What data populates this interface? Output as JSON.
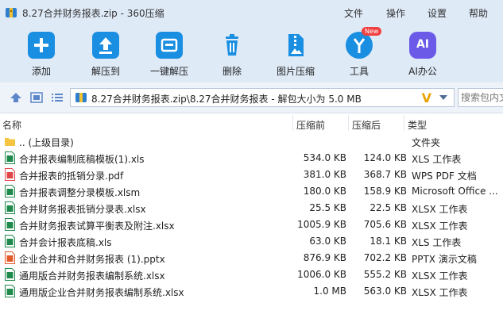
{
  "window": {
    "title": "8.27合并财务报表.zip - 360压缩"
  },
  "menu": {
    "file": "文件",
    "operate": "操作",
    "settings": "设置",
    "help": "帮助"
  },
  "toolbar": {
    "add": "添加",
    "extract_to": "解压到",
    "one_click_extract": "一键解压",
    "delete": "删除",
    "image_compress": "图片压缩",
    "tools": "工具",
    "tools_badge": "New",
    "ai_office": "AI办公",
    "ai_icon_text": "AI"
  },
  "address": {
    "path": "8.27合并财务报表.zip\\8.27合并财务报表 - 解包大小为 5.0 MB",
    "v_mark": "V",
    "search_placeholder": "搜索包内文件"
  },
  "columns": {
    "name": "名称",
    "compressed": "压缩前",
    "packed": "压缩后",
    "type": "类型"
  },
  "files": [
    {
      "name": ".. (上级目录)",
      "compressed": "",
      "packed": "",
      "type": "文件夹",
      "icon": "folder-icon"
    },
    {
      "name": "合并报表编制底稿模板(1).xls",
      "compressed": "534.0 KB",
      "packed": "124.0 KB",
      "type": "XLS 工作表",
      "icon": "excel-file-icon"
    },
    {
      "name": "合并报表的抵销分录.pdf",
      "compressed": "381.0 KB",
      "packed": "368.7 KB",
      "type": "WPS PDF 文档",
      "icon": "pdf-file-icon"
    },
    {
      "name": "合并报表调整分录模板.xlsm",
      "compressed": "180.0 KB",
      "packed": "158.9 KB",
      "type": "Microsoft Office ...",
      "icon": "excel-file-icon"
    },
    {
      "name": "合并财务报表抵销分录表.xlsx",
      "compressed": "25.5 KB",
      "packed": "22.5 KB",
      "type": "XLSX 工作表",
      "icon": "excel-file-icon"
    },
    {
      "name": "合并财务报表试算平衡表及附注.xlsx",
      "compressed": "1005.9 KB",
      "packed": "705.6 KB",
      "type": "XLSX 工作表",
      "icon": "excel-file-icon"
    },
    {
      "name": "合并会计报表底稿.xls",
      "compressed": "63.0 KB",
      "packed": "18.1 KB",
      "type": "XLS 工作表",
      "icon": "excel-file-icon"
    },
    {
      "name": "企业合并和合并财务报表 (1).pptx",
      "compressed": "876.9 KB",
      "packed": "702.2 KB",
      "type": "PPTX 演示文稿",
      "icon": "ppt-file-icon"
    },
    {
      "name": "通用版合并财务报表编制系统.xlsx",
      "compressed": "1006.0 KB",
      "packed": "555.2 KB",
      "type": "XLSX 工作表",
      "icon": "excel-file-icon"
    },
    {
      "name": "通用版企业合并财务报表编制系统.xlsx",
      "compressed": "1.0 MB",
      "packed": "563.0 KB",
      "type": "XLSX 工作表",
      "icon": "excel-file-icon"
    }
  ],
  "colors": {
    "chrome": "#dfeaf7",
    "accent": "#1a8ee0",
    "folder": "#f5c542",
    "excel": "#1f8a4c",
    "pdf": "#e0474c",
    "ppt": "#e35b2a"
  }
}
